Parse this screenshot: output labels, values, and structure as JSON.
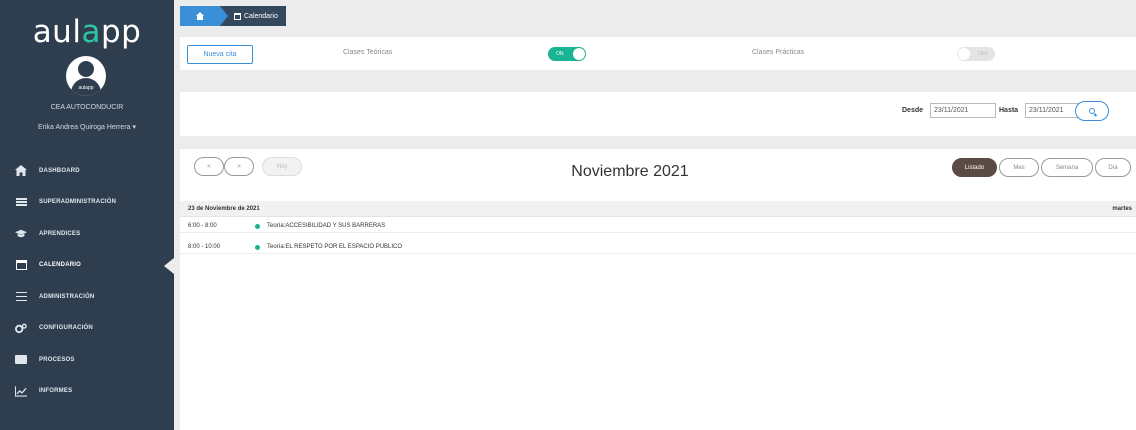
{
  "sidebar": {
    "logo_left": "aul",
    "logo_accent": "a",
    "logo_right": "pp",
    "avatar_label": "aulapp",
    "org": "CEA AUTOCONDUCIR",
    "user": "Erika Andrea Quiroga Herrera",
    "user_caret": "▾",
    "items": [
      {
        "label": "DASHBOARD",
        "icon": "home-icon"
      },
      {
        "label": "SUPERADMINISTRACIÓN",
        "icon": "list-icon"
      },
      {
        "label": "APRENDICES",
        "icon": "graduation-cap-icon"
      },
      {
        "label": "CALENDARIO",
        "icon": "calendar-icon"
      },
      {
        "label": "ADMINISTRACIÓN",
        "icon": "sliders-icon"
      },
      {
        "label": "CONFIGURACIÓN",
        "icon": "cogs-icon"
      },
      {
        "label": "PROCESOS",
        "icon": "folder-icon"
      },
      {
        "label": "INFORMES",
        "icon": "line-chart-icon"
      }
    ]
  },
  "breadcrumb": {
    "current": "Calendario"
  },
  "filters": {
    "new_button": "Nueva cita",
    "theory_label": "Clases Teóricas",
    "theory_toggle": "ON",
    "practice_label": "Clases Prácticas",
    "practice_toggle": "OFF"
  },
  "dates": {
    "from_label": "Desde",
    "from_value": "23/11/2021",
    "to_label": "Hasta",
    "to_value": "23/11/2021"
  },
  "calendar": {
    "prev": "<",
    "next": ">",
    "today": "Hoy",
    "title": "Noviembre 2021",
    "views": [
      "Listado",
      "Mes",
      "Semana",
      "Día"
    ],
    "day_label": "23 de Noviembre de 2021",
    "weekday": "martes",
    "events": [
      {
        "time": "6:00 - 8:00",
        "title": "Teoría:ACCESIBILIDAD Y SUS BARRERAS"
      },
      {
        "time": "8:00 - 10:00",
        "title": "Teoría:EL RESPETO POR EL ESPACIO PUBLICO"
      }
    ]
  },
  "colors": {
    "sidebar": "#2f3e4e",
    "primary": "#3a8fd6",
    "event_dot": "#1ab394",
    "active_view": "#5a4b44"
  }
}
